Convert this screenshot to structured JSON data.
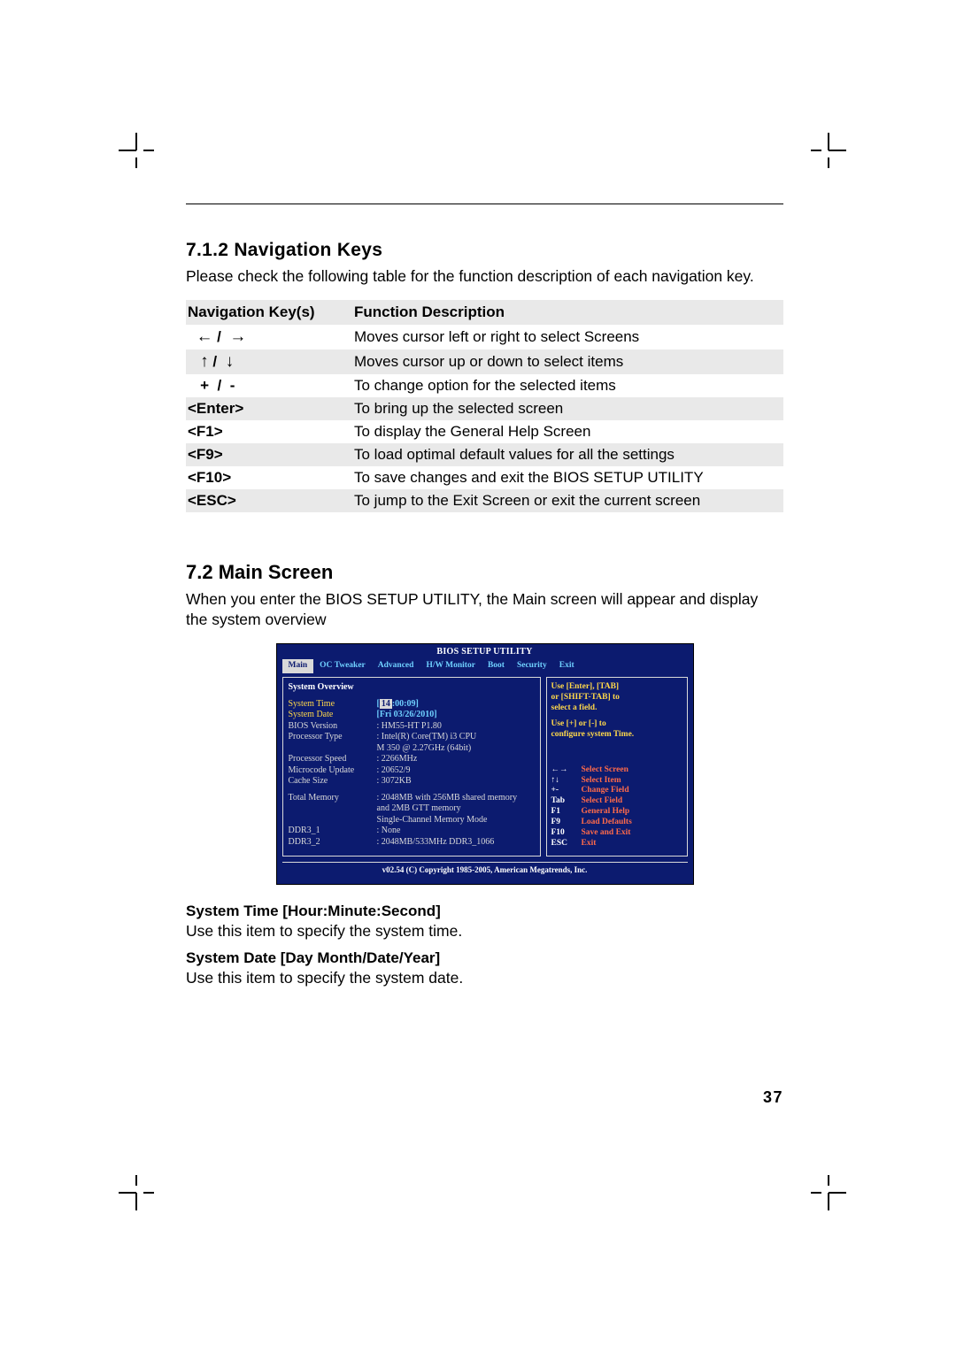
{
  "pageNumber": "37",
  "section1": {
    "heading": "7.1.2 Navigation Keys",
    "intro": "Please check the following table for the function description of each navigation key."
  },
  "navTable": {
    "headers": {
      "col1": "Navigation Key(s)",
      "col2": "Function Description"
    },
    "rows": [
      {
        "keyType": "lr",
        "key": "← / →",
        "desc": "Moves cursor left or right to select Screens"
      },
      {
        "keyType": "ud",
        "key": "↑ / ↓",
        "desc": "Moves cursor up or down to select items"
      },
      {
        "keyType": "text",
        "key": "+  /  -",
        "desc": "To change option for the selected items"
      },
      {
        "keyType": "bold",
        "key": "<Enter>",
        "desc": "To bring up the selected screen"
      },
      {
        "keyType": "bold",
        "key": "<F1>",
        "desc": "To display the General Help Screen"
      },
      {
        "keyType": "bold",
        "key": "<F9>",
        "desc": "To load optimal default values for all the settings"
      },
      {
        "keyType": "bold",
        "key": "<F10>",
        "desc": "To save changes and exit the BIOS SETUP UTILITY"
      },
      {
        "keyType": "bold",
        "key": "<ESC>",
        "desc": "To jump to the Exit Screen or exit the current screen"
      }
    ]
  },
  "section2": {
    "heading": "7.2  Main Screen",
    "intro": "When you enter the BIOS SETUP UTILITY, the Main screen will appear and display the system overview"
  },
  "bios": {
    "title": "BIOS SETUP UTILITY",
    "tabs": [
      "Main",
      "OC Tweaker",
      "Advanced",
      "H/W Monitor",
      "Boot",
      "Security",
      "Exit"
    ],
    "activeTab": 0,
    "overviewHeading": "System Overview",
    "fields": {
      "systemTimeLabel": "System Time",
      "systemTimeHour": "14",
      "systemTimeRest": ":00:09",
      "systemDateLabel": "System Date",
      "systemDateValue": "[Fri 03/26/2010]",
      "biosVersionLabel": "BIOS Version",
      "biosVersionValue": ": HM55-HT P1.80",
      "processorTypeLabel": "Processor Type",
      "processorTypeValue": ": Intel(R) Core(TM) i3 CPU",
      "processorTypeValue2": "  M 350 @ 2.27GHz (64bit)",
      "processorSpeedLabel": "Processor Speed",
      "processorSpeedValue": ": 2266MHz",
      "microcodeLabel": "Microcode Update",
      "microcodeValue": ": 20652/9",
      "cacheSizeLabel": "Cache Size",
      "cacheSizeValue": ": 3072KB",
      "totalMemoryLabel": "Total Memory",
      "totalMemoryValue": ": 2048MB with 256MB shared memory",
      "totalMemoryValue2": "  and 2MB GTT memory",
      "totalMemoryValue3": "  Single-Channel Memory Mode",
      "ddr1Label": "  DDR3_1",
      "ddr1Value": ": None",
      "ddr2Label": "  DDR3_2",
      "ddr2Value": ": 2048MB/533MHz DDR3_1066"
    },
    "help": {
      "line1": "Use [Enter], [TAB]",
      "line2": "or [SHIFT-TAB] to",
      "line3": "select a field.",
      "line4": "Use [+] or [-] to",
      "line5": "configure system Time."
    },
    "legend": [
      {
        "k": "←→",
        "d": "Select Screen"
      },
      {
        "k": "↑↓",
        "d": "Select Item"
      },
      {
        "k": "+-",
        "d": "Change Field"
      },
      {
        "k": "Tab",
        "d": "Select Field"
      },
      {
        "k": "F1",
        "d": "General Help"
      },
      {
        "k": "F9",
        "d": "Load Defaults"
      },
      {
        "k": "F10",
        "d": "Save and Exit"
      },
      {
        "k": "ESC",
        "d": "Exit"
      }
    ],
    "footer": "v02.54 (C) Copyright 1985-2005, American Megatrends, Inc."
  },
  "subsections": {
    "sysTimeHead": "System Time [Hour:Minute:Second]",
    "sysTimePara": "Use this item to specify the system time.",
    "sysDateHead": "System Date [Day Month/Date/Year]",
    "sysDatePara": "Use this item to specify the system date."
  }
}
